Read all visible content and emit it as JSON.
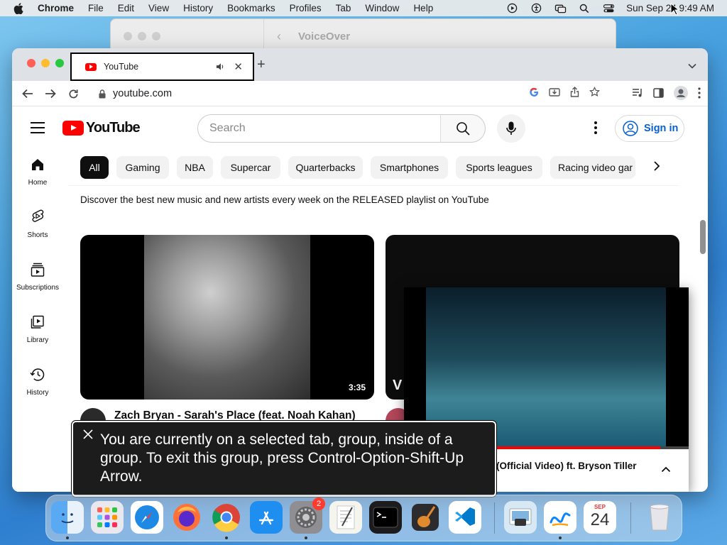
{
  "menubar": {
    "app_name": "Chrome",
    "menus": [
      "File",
      "Edit",
      "View",
      "History",
      "Bookmarks",
      "Profiles",
      "Tab",
      "Window",
      "Help"
    ],
    "clock": "Sun Sep 24 9:49 AM"
  },
  "voiceover_window": {
    "title": "VoiceOver",
    "back_icon": "chevron-left-icon"
  },
  "browser": {
    "tab": {
      "title": "YouTube",
      "audio_icon": "speaker-icon",
      "close_icon": "close-icon"
    },
    "new_tab_icon": "plus-icon",
    "address": {
      "url": "youtube.com"
    }
  },
  "youtube": {
    "logo_text": "YouTube",
    "search": {
      "placeholder": "Search"
    },
    "signin_label": "Sign in",
    "sidebar": [
      {
        "label": "Home",
        "icon": "home-icon"
      },
      {
        "label": "Shorts",
        "icon": "shorts-icon"
      },
      {
        "label": "Subscriptions",
        "icon": "subscriptions-icon"
      },
      {
        "label": "Library",
        "icon": "library-icon"
      },
      {
        "label": "History",
        "icon": "history-icon"
      }
    ],
    "chips": [
      "All",
      "Gaming",
      "NBA",
      "Supercar",
      "Quarterbacks",
      "Smartphones",
      "Sports leagues",
      "Racing video gar"
    ],
    "active_chip": "All",
    "promo_text": "Discover the best new music and new artists every week on the RELEASED playlist on YouTube",
    "videos": [
      {
        "title": "Zach Bryan - Sarah's Place (feat. Noah Kahan)",
        "duration": "3:35"
      },
      {
        "channel_mark": "V"
      }
    ],
    "miniplayer": {
      "title": "(Official Video) ft. Bryson Tiller",
      "progress": 0.9
    }
  },
  "voiceover_caption": {
    "text": "You are currently on a selected tab, group, inside of a group.  To exit this group, press Control-Option-Shift-Up Arrow."
  },
  "dock": {
    "settings_badge": "2",
    "calendar": {
      "month": "SEP",
      "day": "24"
    }
  },
  "colors": {
    "youtube_red": "#ff0000",
    "link_blue": "#065fd4",
    "caption_bg": "#1c1c1c"
  }
}
